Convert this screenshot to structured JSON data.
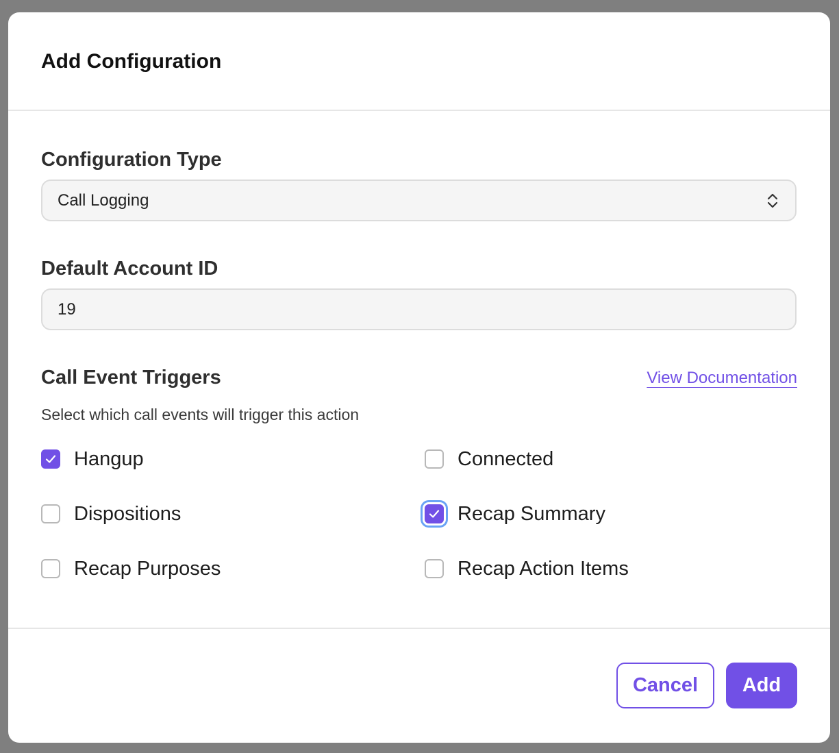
{
  "dialog": {
    "title": "Add Configuration"
  },
  "form": {
    "configuration_type": {
      "label": "Configuration Type",
      "selected": "Call Logging"
    },
    "default_account_id": {
      "label": "Default Account ID",
      "value": "19"
    }
  },
  "triggers": {
    "title": "Call Event Triggers",
    "doc_link": "View Documentation",
    "description": "Select which call events will trigger this action",
    "items": [
      {
        "label": "Hangup",
        "checked": true,
        "focused": false
      },
      {
        "label": "Connected",
        "checked": false,
        "focused": false
      },
      {
        "label": "Dispositions",
        "checked": false,
        "focused": false
      },
      {
        "label": "Recap Summary",
        "checked": true,
        "focused": true
      },
      {
        "label": "Recap Purposes",
        "checked": false,
        "focused": false
      },
      {
        "label": "Recap Action Items",
        "checked": false,
        "focused": false
      }
    ]
  },
  "footer": {
    "cancel_label": "Cancel",
    "add_label": "Add"
  },
  "colors": {
    "accent": "#7150e6",
    "focus_ring": "#6aa3f5",
    "backdrop": "#7f7f7f"
  }
}
